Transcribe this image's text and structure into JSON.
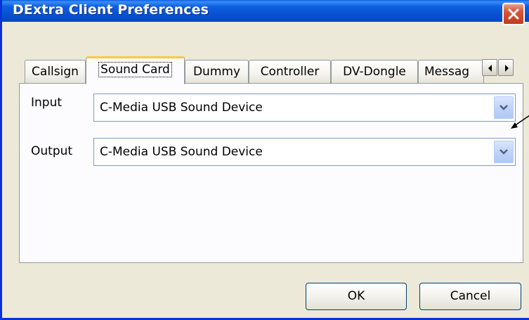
{
  "window": {
    "title": "DExtra Client Preferences"
  },
  "tabs": [
    {
      "label": "Callsign",
      "active": false
    },
    {
      "label": "Sound Card",
      "active": true
    },
    {
      "label": "Dummy",
      "active": false
    },
    {
      "label": "Controller",
      "active": false
    },
    {
      "label": "DV-Dongle",
      "active": false
    },
    {
      "label": "Messag",
      "active": false
    }
  ],
  "sound_card": {
    "input_label": "Input",
    "input_value": "C-Media USB Sound Device",
    "output_label": "Output",
    "output_value": "C-Media USB Sound Device"
  },
  "buttons": {
    "ok": "OK",
    "cancel": "Cancel"
  },
  "icons": {
    "close": "close-icon",
    "tab_left": "chevron-left-icon",
    "tab_right": "chevron-right-icon",
    "dropdown": "chevron-down-icon"
  },
  "colors": {
    "titlebar": "#0a5ee0",
    "close": "#d8583a",
    "active_tab_accent": "#ffc83c",
    "combo_border": "#7f9db9"
  }
}
